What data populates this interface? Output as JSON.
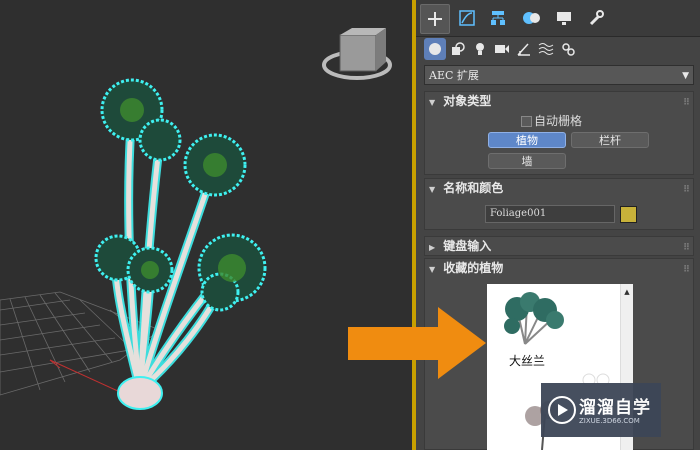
{
  "viewport": {
    "label": "perspective-viewport"
  },
  "command_panel": {
    "tabs": [
      "create-icon",
      "modify-icon",
      "hierarchy-icon",
      "motion-icon",
      "display-icon",
      "utilities-icon"
    ],
    "categories": [
      "geometry-icon",
      "shapes-icon",
      "lights-icon",
      "cameras-icon",
      "helpers-icon",
      "spacewarps-icon",
      "systems-icon"
    ],
    "dropdown": {
      "value": "AEC 扩展",
      "arrow": "▼"
    },
    "object_type": {
      "title": "对象类型",
      "autogrid_label": "自动栅格",
      "buttons": [
        "植物",
        "栏杆",
        "墙"
      ]
    },
    "name_color": {
      "title": "名称和颜色",
      "name_value": "Foliage001",
      "color": "#c8b23a"
    },
    "keyboard_entry": {
      "title": "键盘输入"
    },
    "favorite_plants": {
      "title": "收藏的植物",
      "items": [
        "大丝兰"
      ]
    }
  },
  "watermark": {
    "title": "溜溜自学",
    "subtitle": "ZIXUE.3D66.COM"
  },
  "colors": {
    "accent": "#5e87c9",
    "arrow": "#f08c10",
    "selection_outline": "#3ff0f0"
  }
}
